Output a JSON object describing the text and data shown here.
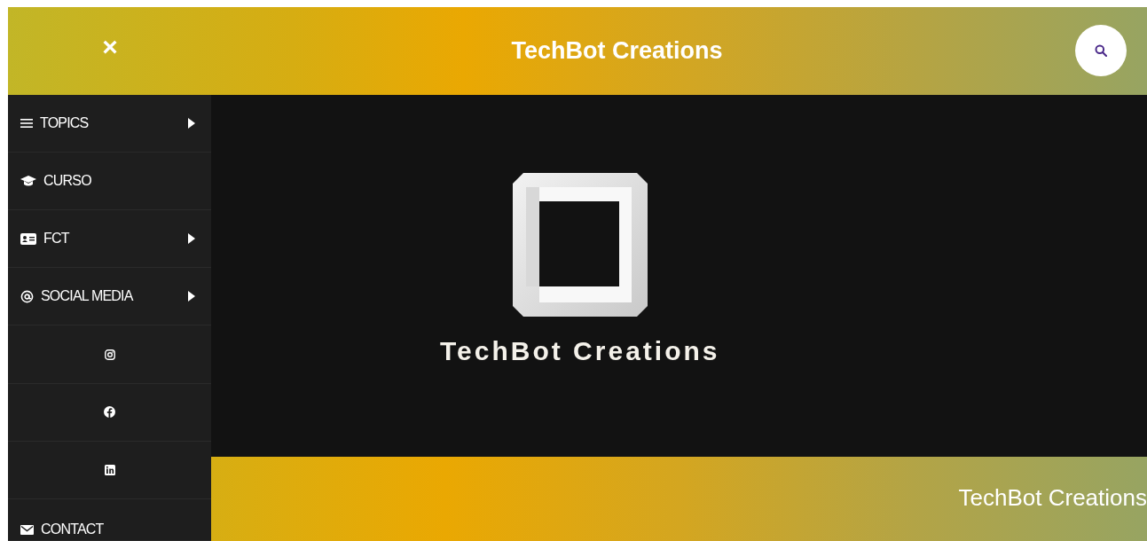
{
  "header": {
    "close_symbol": "×",
    "title": "TechBot Creations"
  },
  "sidebar": {
    "items": [
      {
        "kind": "menu",
        "label": "TOPICS",
        "has_submenu": true
      },
      {
        "kind": "menu",
        "label": "CURSO",
        "has_submenu": false
      },
      {
        "kind": "menu",
        "label": "FCT",
        "has_submenu": true
      },
      {
        "kind": "menu",
        "label": "SOCIAL MEDIA",
        "has_submenu": true
      },
      {
        "kind": "social"
      },
      {
        "kind": "social"
      },
      {
        "kind": "social"
      },
      {
        "kind": "menu",
        "label": "CONTACT",
        "has_submenu": false
      }
    ]
  },
  "hero": {
    "logo_text": "TechBot Creations"
  },
  "footer": {
    "text": "TechBot Creations"
  }
}
